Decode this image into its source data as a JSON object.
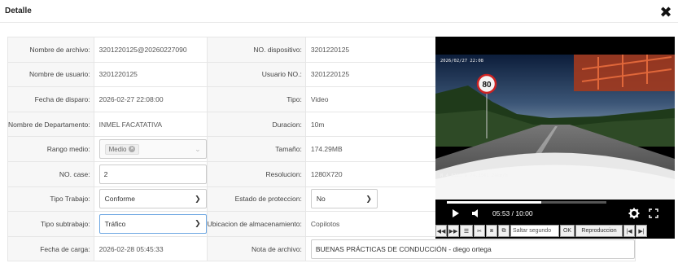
{
  "window": {
    "title": "Detalle",
    "close_label": "✖"
  },
  "form": {
    "file_name_label": "Nombre de archivo:",
    "file_name_value": "3201220125@20260227090",
    "device_no_label": "NO. dispositivo:",
    "device_no_value": "3201220125",
    "user_name_label": "Nombre de usuario:",
    "user_name_value": "3201220125",
    "user_no_label": "Usuario NO.:",
    "user_no_value": "3201220125",
    "trigger_date_label": "Fecha de disparo:",
    "trigger_date_value": "2026-02-27 22:08:00",
    "type_label": "Tipo:",
    "type_value": "Video",
    "department_label": "Nombre de Departamento:",
    "department_value": "INMEL FACATATIVA",
    "duration_label": "Duracion:",
    "duration_value": "10m",
    "range_label": "Rango medio:",
    "range_tag": "Medio",
    "size_label": "Tamaño:",
    "size_value": "174.29MB",
    "case_no_label": "NO. case:",
    "case_no_value": "2",
    "resolution_label": "Resolucion:",
    "resolution_value": "1280X720",
    "work_type_label": "Tipo Trabajo:",
    "work_type_value": "Conforme",
    "protection_label": "Estado de proteccion:",
    "protection_value": "No",
    "subtype_label": "Tipo subtrabajo:",
    "subtype_value": "Tráfico",
    "storage_label": "Ubicacion de almacenamiento:",
    "storage_value": "Copilotos",
    "upload_date_label": "Fecha de carga:",
    "upload_date_value": "2026-02-28 05:45:33",
    "note_label": "Nota de archivo:",
    "note_value": "BUENAS PRÁCTICAS DE CONDUCCIÓN - diego ortega"
  },
  "player": {
    "time_display": "05:53 / 10:00",
    "progress": 0.59,
    "speed_sign": "80",
    "osd_top": "2026/02/27 22:08",
    "osd_bottom": "N 4.8123 W 74.3541 24km/h",
    "icons": {
      "play": "play-icon",
      "volume": "volume-icon",
      "settings": "gear-icon",
      "fullscreen": "fullscreen-icon"
    }
  },
  "toolbar": {
    "rewind": "◀◀",
    "forward": "▶▶",
    "list": "☰",
    "cut": "✂",
    "frame_back": "⧈",
    "frame_fwd": "⧉",
    "seek_placeholder": "Saltar segundo",
    "ok_label": "OK",
    "playback_label": "Reproduccion",
    "prev_label": "|◀",
    "next_label": "▶|"
  },
  "colors": {
    "label_bg": "#f7f7f7",
    "border": "#e6e6e6",
    "focus_border": "#6da7e2",
    "player_bg": "#000000"
  }
}
